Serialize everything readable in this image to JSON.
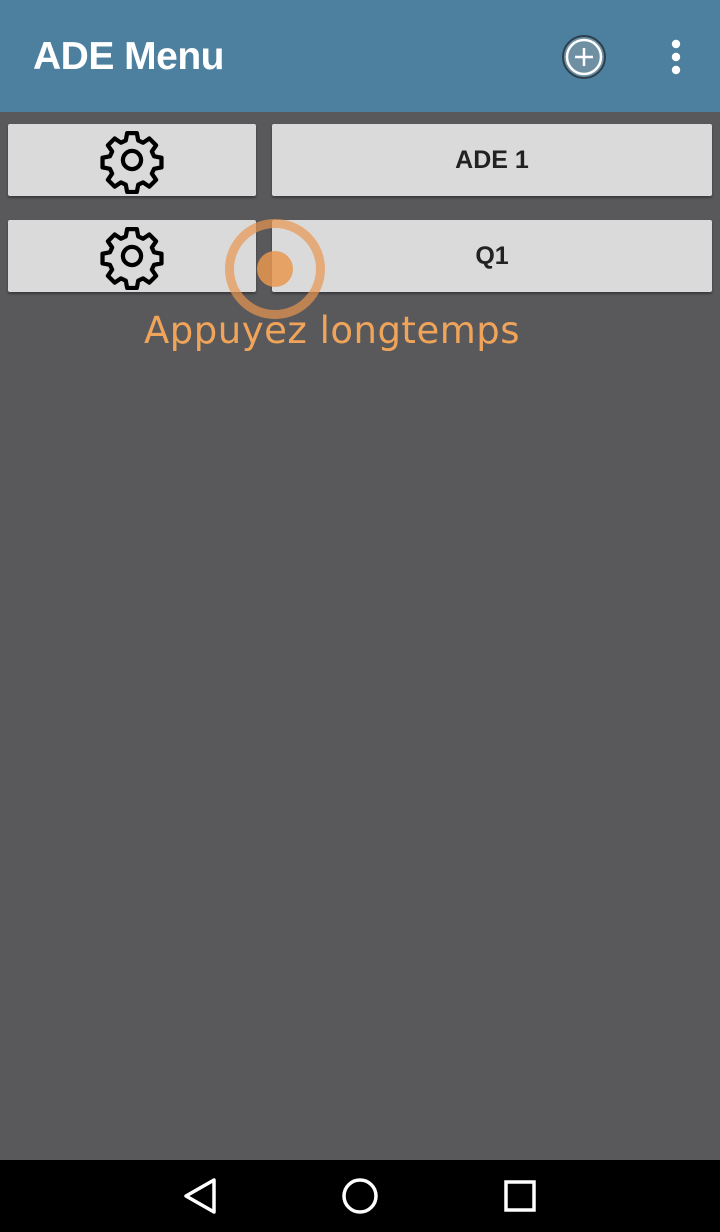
{
  "app_bar": {
    "title": "ADE Menu",
    "color": "#4d809f",
    "actions": [
      {
        "name": "add",
        "icon": "add-circle-icon"
      },
      {
        "name": "overflow",
        "icon": "more-vert-icon"
      }
    ]
  },
  "rows": [
    {
      "settings_icon": "gear-icon",
      "label": "ADE 1"
    },
    {
      "settings_icon": "gear-icon",
      "label": "Q1"
    }
  ],
  "tap_hint": {
    "text": "Appuyez longtemps",
    "color": "#f0a45a"
  },
  "nav_bar": {
    "buttons": [
      {
        "name": "back",
        "icon": "back-triangle-icon"
      },
      {
        "name": "home",
        "icon": "home-circle-icon"
      },
      {
        "name": "recents",
        "icon": "recents-square-icon"
      }
    ]
  },
  "colors": {
    "background": "#59595b",
    "button": "#dadada"
  }
}
